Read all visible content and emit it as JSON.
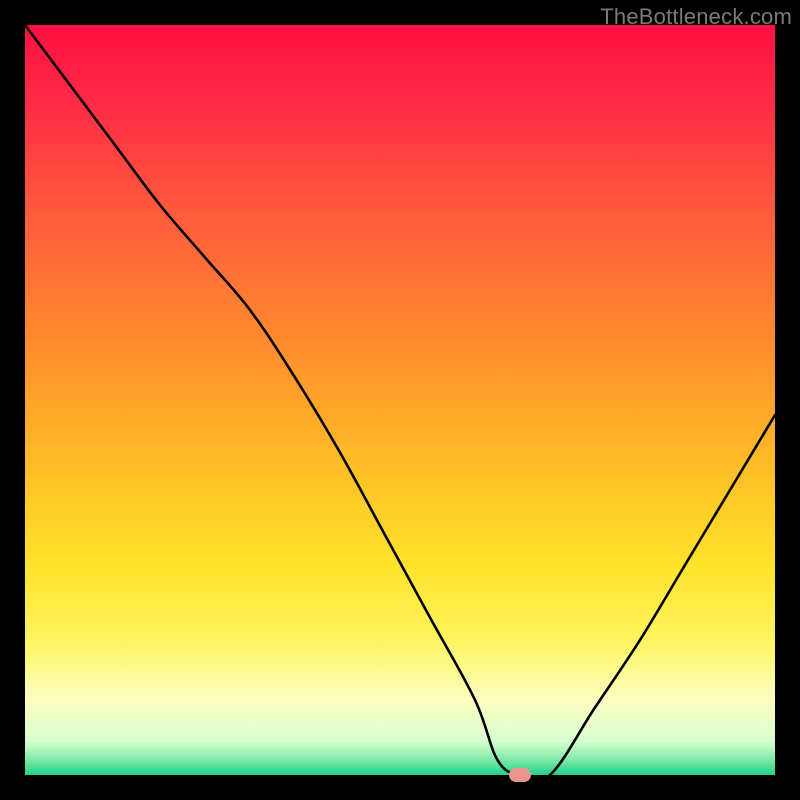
{
  "watermark": "TheBottleneck.com",
  "marker": {
    "x_pct": 66,
    "y_pct": 100
  },
  "chart_data": {
    "type": "line",
    "title": "",
    "xlabel": "",
    "ylabel": "",
    "xlim": [
      0,
      100
    ],
    "ylim": [
      0,
      100
    ],
    "series": [
      {
        "name": "bottleneck-curve",
        "x": [
          0,
          6,
          12,
          18,
          24,
          30,
          36,
          42,
          48,
          54,
          60,
          63,
          66,
          70,
          76,
          82,
          88,
          94,
          100
        ],
        "y": [
          100,
          92,
          84,
          76,
          69,
          62,
          53,
          43,
          32,
          21,
          10,
          2,
          0,
          0,
          9,
          18,
          28,
          38,
          48
        ]
      }
    ],
    "gradient_stops": [
      {
        "offset": 0.0,
        "color": "#ff1042"
      },
      {
        "offset": 0.1,
        "color": "#ff2a46"
      },
      {
        "offset": 0.25,
        "color": "#ff5a3c"
      },
      {
        "offset": 0.42,
        "color": "#ff8b2e"
      },
      {
        "offset": 0.58,
        "color": "#ffbb26"
      },
      {
        "offset": 0.72,
        "color": "#ffe22a"
      },
      {
        "offset": 0.82,
        "color": "#fff55f"
      },
      {
        "offset": 0.9,
        "color": "#fbffc0"
      },
      {
        "offset": 0.955,
        "color": "#d8ffd0"
      },
      {
        "offset": 0.98,
        "color": "#7de9a6"
      },
      {
        "offset": 1.0,
        "color": "#1fd18c"
      }
    ]
  }
}
